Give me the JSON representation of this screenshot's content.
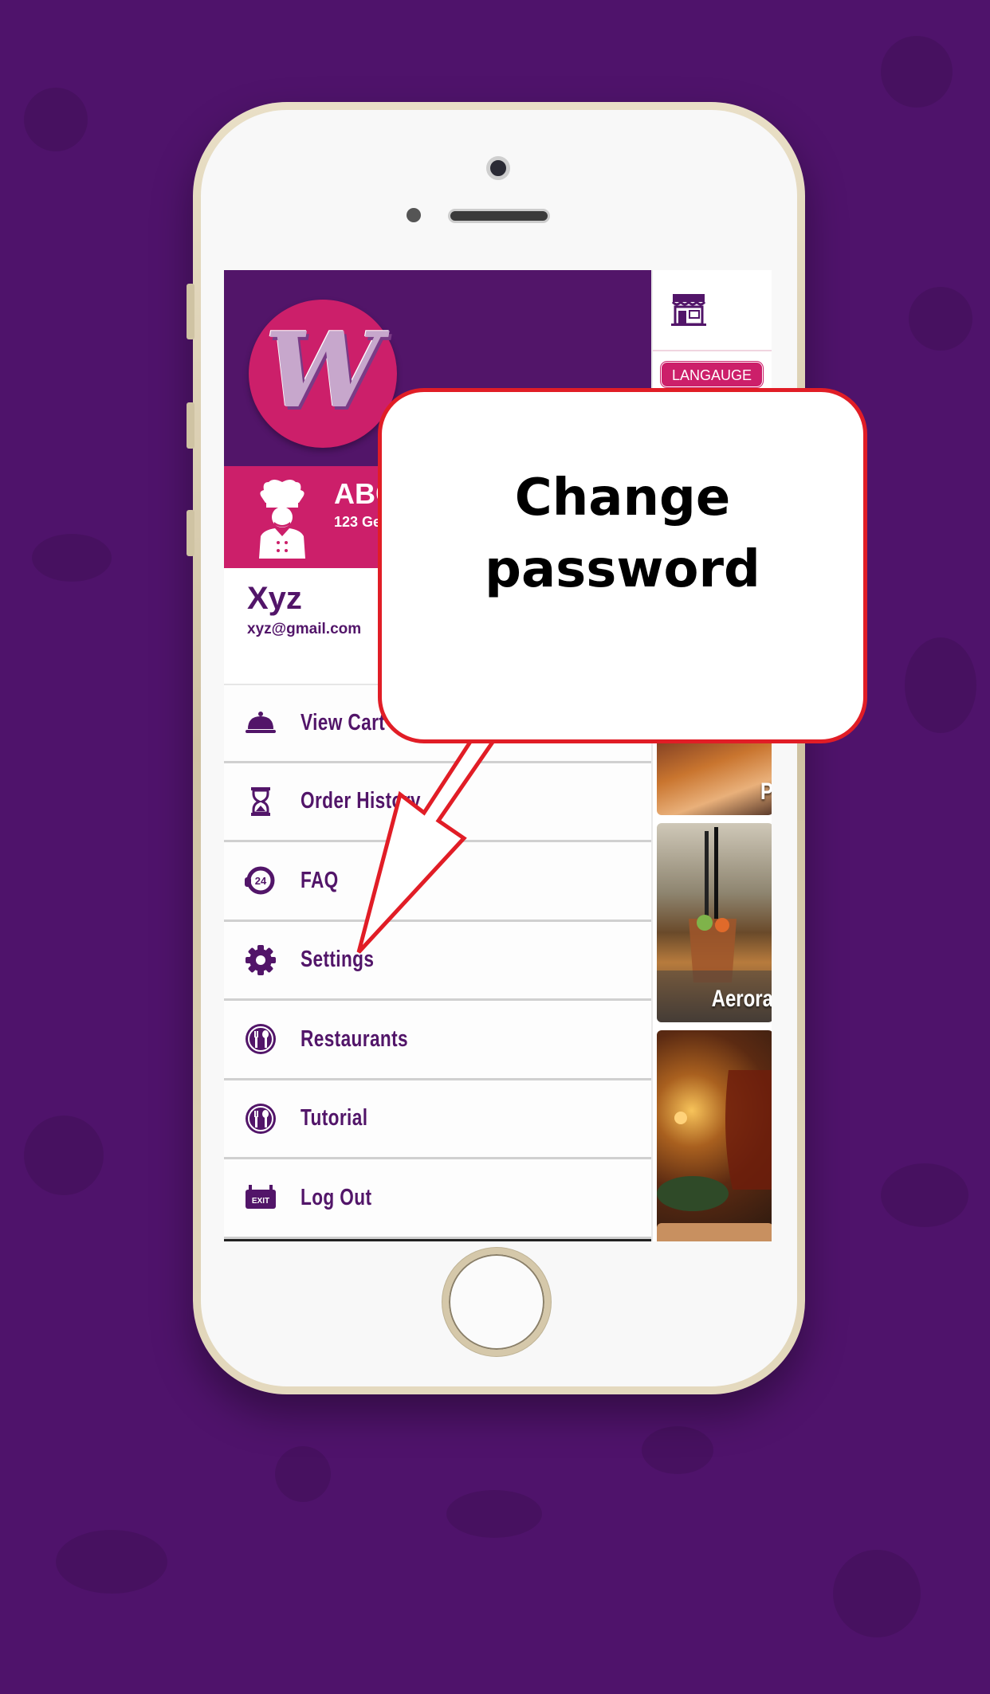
{
  "callout": {
    "line1": "Change",
    "line2": "password"
  },
  "restaurant": {
    "name": "ABC",
    "address": "123 Ge"
  },
  "user": {
    "name": "Xyz",
    "email": "xyz@gmail.com"
  },
  "menu": [
    {
      "label": "View Cart",
      "icon": "cloche-icon"
    },
    {
      "label": "Order History",
      "icon": "hourglass-icon"
    },
    {
      "label": "FAQ",
      "icon": "support-24-icon"
    },
    {
      "label": "Settings",
      "icon": "gear-icon"
    },
    {
      "label": "Restaurants",
      "icon": "fork-spoon-icon"
    },
    {
      "label": "Tutorial",
      "icon": "fork-spoon-icon"
    },
    {
      "label": "Log Out",
      "icon": "exit-icon"
    }
  ],
  "right_panel": {
    "language_label": "LANGAUGE",
    "thumbs": [
      {
        "caption": "P"
      },
      {
        "caption": "Aerora"
      },
      {
        "caption": ""
      }
    ]
  },
  "icons": {
    "exit_text": "EXIT",
    "faq_text": "24"
  },
  "colors": {
    "brand_purple": "#521569",
    "brand_pink": "#cc1f6a",
    "callout_red": "#e11d26",
    "background": "#4f136b"
  }
}
